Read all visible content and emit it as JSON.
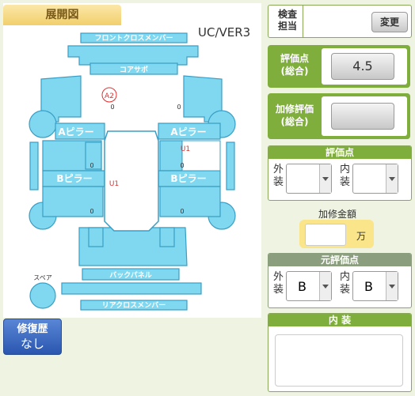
{
  "title": "展開図",
  "version": "UC/VER3",
  "diagram": {
    "parts": {
      "front_cross_member": "フロントクロスメンバー",
      "core_support": "コアサポ",
      "a_pillar_left": "Aピラー",
      "a_pillar_right": "Aピラー",
      "b_pillar_left": "Bピラー",
      "b_pillar_right": "Bピラー",
      "back_panel": "バックパネル",
      "rear_cross_member": "リアクロスメンバー",
      "spare": "スペア"
    },
    "marks": {
      "a2": "A2",
      "u1_right": "U1",
      "u1_center": "U1"
    },
    "small_marks": [
      "0",
      "0",
      "0",
      "0",
      "0",
      "0"
    ]
  },
  "history_button": {
    "label": "修復歴",
    "value": "なし"
  },
  "inspector": {
    "label_line1": "検査",
    "label_line2": "担当",
    "change_button": "変更"
  },
  "score_total": {
    "label_line1": "評価点",
    "label_line2": "(総合)",
    "value": "4.5"
  },
  "repair_score": {
    "label_line1": "加修評価",
    "label_line2": "(総合)",
    "value": ""
  },
  "score": {
    "header": "評価点",
    "exterior_label_1": "外",
    "exterior_label_2": "装",
    "interior_label_1": "内",
    "interior_label_2": "装",
    "exterior_value": "",
    "interior_value": ""
  },
  "repair_amount": {
    "label": "加修金額",
    "value": "",
    "unit": "万"
  },
  "original_score": {
    "header": "元評価点",
    "exterior_label_1": "外",
    "exterior_label_2": "装",
    "interior_label_1": "内",
    "interior_label_2": "装",
    "exterior_value": "B",
    "interior_value": "B"
  },
  "interior_notes": {
    "header": "内 装",
    "value": ""
  },
  "colors": {
    "panel_blue": "#7fd7f0",
    "panel_stroke": "#3a9ec4",
    "green_head": "#7fae3c",
    "accent_red": "#e03030"
  }
}
